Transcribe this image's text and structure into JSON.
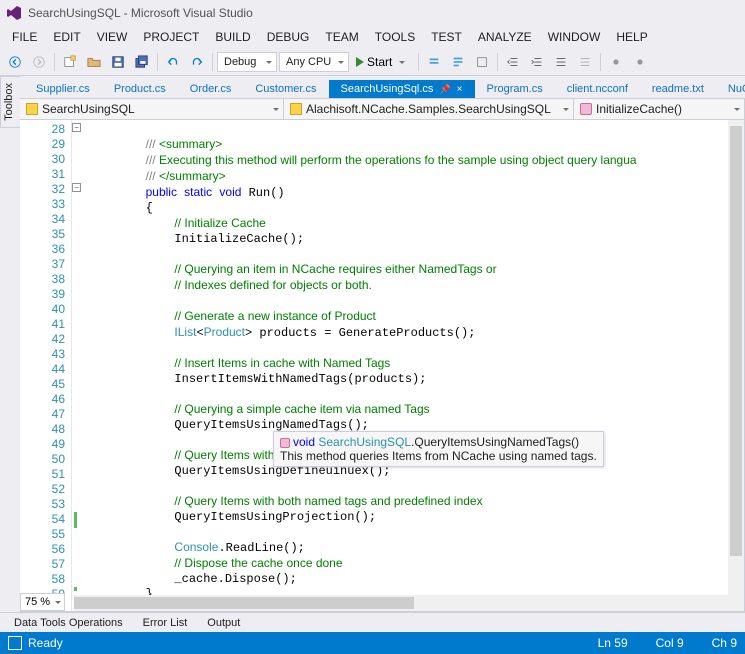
{
  "title": "SearchUsingSQL - Microsoft Visual Studio",
  "menus": [
    "FILE",
    "EDIT",
    "VIEW",
    "PROJECT",
    "BUILD",
    "DEBUG",
    "TEAM",
    "TOOLS",
    "TEST",
    "ANALYZE",
    "WINDOW",
    "HELP"
  ],
  "toolbar": {
    "config": "Debug",
    "platform": "Any CPU",
    "start": "Start"
  },
  "sidetab": "Toolbox",
  "tabs": {
    "items": [
      "Supplier.cs",
      "Product.cs",
      "Order.cs",
      "Customer.cs",
      "SearchUsingSql.cs",
      "Program.cs",
      "client.ncconf",
      "readme.txt",
      "NuGet: Se"
    ],
    "activeIndex": 4
  },
  "breadcrumbs": {
    "project": "SearchUsingSQL",
    "class": "Alachisoft.NCache.Samples.SearchUsingSQL",
    "member": "InitializeCache()"
  },
  "editor": {
    "startLine": 28,
    "endLine": 59,
    "zoom": "75 %",
    "lines": [
      "",
      "        /// <summary>",
      "        /// Executing this method will perform the operations fo the sample using object query langua",
      "        /// </summary>",
      "        public static void Run()",
      "        {",
      "            // Initialize Cache",
      "            InitializeCache();",
      "",
      "            // Querying an item in NCache requires either NamedTags or",
      "            // Indexes defined for objects or both.",
      "",
      "            // Generate a new instance of Product",
      "            IList<Product> products = GenerateProducts();",
      "",
      "            // Insert Items in cache with Named Tags",
      "            InsertItemsWithNamedTags(products);",
      "",
      "            // Querying a simple cache item via named Tags",
      "            QueryItemsUsingNamedTags();",
      "",
      "            // Query Items with d",
      "            QueryItemsUsingDefineuinuex();",
      "",
      "            // Query Items with both named tags and predefined index",
      "            QueryItemsUsingProjection();",
      "",
      "            Console.ReadLine();",
      "            // Dispose the cache once done",
      "            _cache.Dispose();",
      "        }",
      ""
    ]
  },
  "tooltip": {
    "sig_kw": "void",
    "sig_type": "SearchUsingSQL",
    "sig_rest": ".QueryItemsUsingNamedTags()",
    "desc": "This method queries Items from NCache using named tags."
  },
  "tooltabs": [
    "Data Tools Operations",
    "Error List",
    "Output"
  ],
  "status": {
    "state": "Ready",
    "ln": "Ln 59",
    "col": "Col 9",
    "ch": "Ch 9"
  },
  "chart_data": null
}
